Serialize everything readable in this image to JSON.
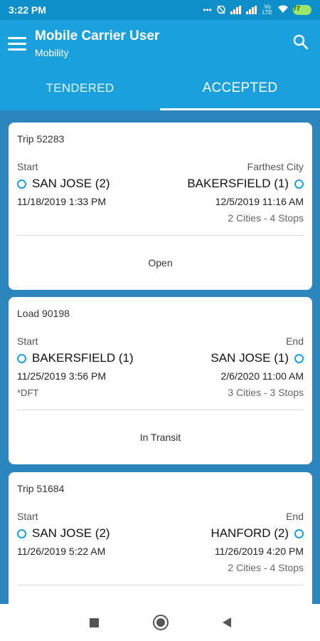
{
  "status_bar": {
    "time": "3:22 PM",
    "network": "Vo LTE",
    "battery": "77"
  },
  "app_bar": {
    "title": "Mobile Carrier User",
    "subtitle": "Mobility"
  },
  "tabs": [
    {
      "label": "TENDERED",
      "active": false
    },
    {
      "label": "ACCEPTED",
      "active": true
    }
  ],
  "cards": [
    {
      "id": "Trip 52283",
      "start_label": "Start",
      "end_label": "Farthest City",
      "start_city": "SAN JOSE (2)",
      "end_city": "BAKERSFIELD (1)",
      "start_date": "11/18/2019 1:33 PM",
      "end_date": "12/5/2019 11:16 AM",
      "note": "",
      "summary": "2 Cities - 4 Stops",
      "status": "Open"
    },
    {
      "id": "Load 90198",
      "start_label": "Start",
      "end_label": "End",
      "start_city": "BAKERSFIELD (1)",
      "end_city": "SAN JOSE (1)",
      "start_date": "11/25/2019 3:56 PM",
      "end_date": "2/6/2020 11:00 AM",
      "note": "*DFT",
      "summary": "3 Cities - 3 Stops",
      "status": "In Transit"
    },
    {
      "id": "Trip 51684",
      "start_label": "Start",
      "end_label": "End",
      "start_city": "SAN JOSE (2)",
      "end_city": "HANFORD (2)",
      "start_date": "11/26/2019 5:22 AM",
      "end_date": "11/26/2019 4:20 PM",
      "note": "",
      "summary": "2 Cities - 4 Stops",
      "status": ""
    }
  ],
  "colors": {
    "primary": "#1aa1dd",
    "status_bar": "#0f8fc9",
    "list_background": "#2a86bd",
    "accent_ring": "#1aa1dd"
  },
  "icons": {
    "menu": "hamburger-icon",
    "search": "search-icon",
    "location": "ring-icon",
    "nav_recents": "square-icon",
    "nav_home": "circle-icon",
    "nav_back": "triangle-back-icon"
  }
}
